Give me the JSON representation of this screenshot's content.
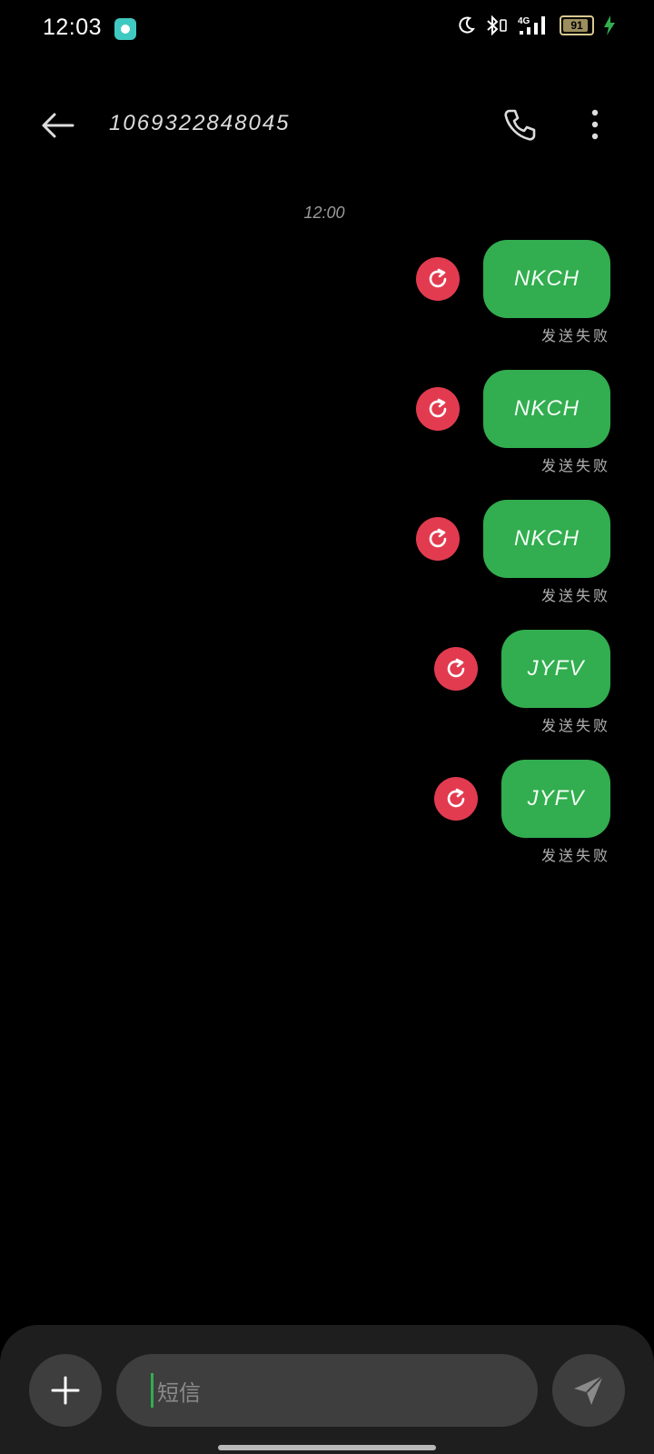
{
  "status_bar": {
    "time": "12:03",
    "battery_level": "91",
    "battery_fraction": 0.91
  },
  "header": {
    "title": "1069322848045"
  },
  "conversation": {
    "timestamp": "12:00"
  },
  "messages": [
    {
      "text": "NKCH",
      "status": "发送失败"
    },
    {
      "text": "NKCH",
      "status": "发送失败"
    },
    {
      "text": "NKCH",
      "status": "发送失败"
    },
    {
      "text": "JYFV",
      "status": "发送失败"
    },
    {
      "text": "JYFV",
      "status": "发送失败"
    }
  ],
  "composer": {
    "placeholder": "短信"
  },
  "colors": {
    "bubble": "#32ad4f",
    "retry": "#e23b50",
    "background": "#000000"
  }
}
